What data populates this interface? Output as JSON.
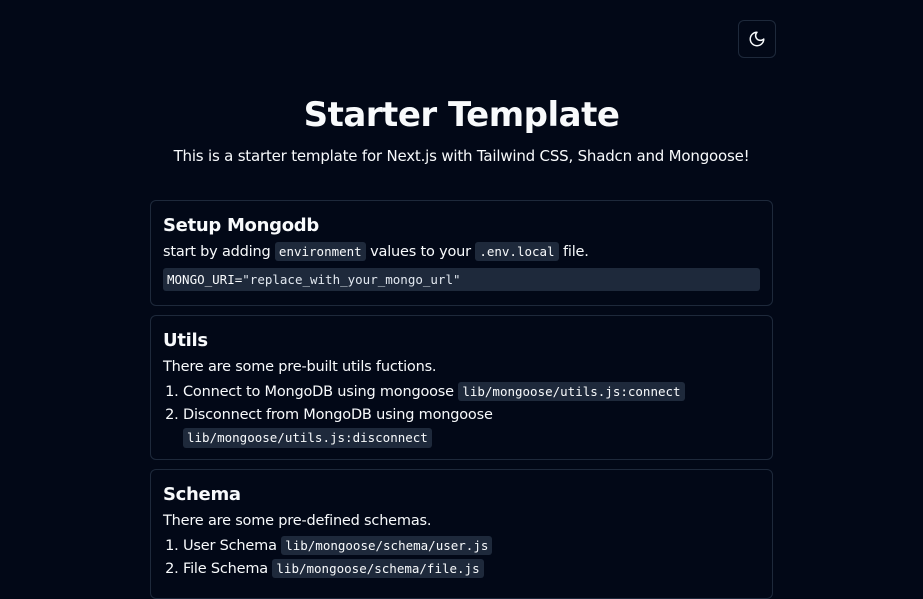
{
  "header": {
    "theme_toggle_icon": "moon-icon"
  },
  "hero": {
    "title": "Starter Template",
    "subtitle": "This is a starter template for Next.js with Tailwind CSS, Shadcn and Mongoose!"
  },
  "setup": {
    "title": "Setup Mongodb",
    "text_before": "start by adding",
    "code_env": "environment",
    "text_middle": "values to your",
    "code_file": ".env.local",
    "text_after": "file.",
    "code_key": "MONGO_URI",
    "code_eq": "=",
    "code_value": "\"replace_with_your_mongo_url\""
  },
  "utils": {
    "title": "Utils",
    "description": "There are some pre-built utils fuctions.",
    "items": [
      {
        "label": "Connect to MongoDB using mongoose",
        "code": "lib/mongoose/utils.js:connect"
      },
      {
        "label": "Disconnect from MongoDB using mongoose",
        "code": "lib/mongoose/utils.js:disconnect"
      }
    ]
  },
  "schema": {
    "title": "Schema",
    "description": "There are some pre-defined schemas.",
    "items": [
      {
        "label": "User Schema",
        "code": "lib/mongoose/schema/user.js"
      },
      {
        "label": "File Schema",
        "code": "lib/mongoose/schema/file.js"
      }
    ]
  },
  "colors": {
    "background": "#020817",
    "foreground": "#f8fafc",
    "border": "#1e293b",
    "code_bg": "#1e293b"
  }
}
